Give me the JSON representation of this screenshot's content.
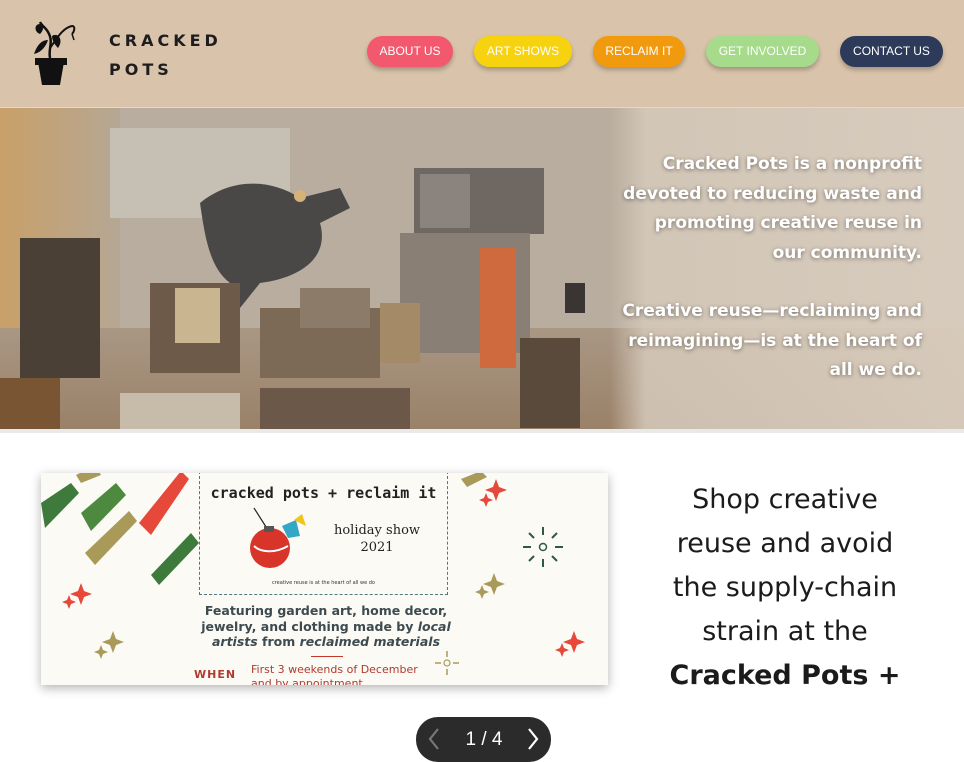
{
  "brand": {
    "line1": "CRACKED",
    "line2": "POTS"
  },
  "nav": [
    {
      "label": "ABOUT US",
      "color": "#f2586e"
    },
    {
      "label": "ART SHOWS",
      "color": "#f7d20e"
    },
    {
      "label": "RECLAIM IT",
      "color": "#f19a0e"
    },
    {
      "label": "GET INVOLVED",
      "color": "#a6db8b"
    },
    {
      "label": "CONTACT US",
      "color": "#2d3a5a"
    }
  ],
  "hero": {
    "para1": "Cracked Pots is a nonprofit devoted to reducing waste and promoting creative reuse in our community.",
    "para2": "Creative reuse—reclaiming and reimagining—is at the heart of all we do."
  },
  "slide": {
    "title": "cracked pots + reclaim it",
    "subtitle1": "holiday show",
    "subtitle2": "2021",
    "tagline": "creative reuse is at the heart of all we do",
    "desc_line1": "Featuring garden art, home decor,",
    "desc_line2a": "jewelry, and clothing made by ",
    "desc_line2b": "local",
    "desc_line3a": "artists",
    "desc_line3b": " from ",
    "desc_line3c": "reclaimed materials",
    "when_label": "WHEN",
    "when_line1": "First 3 weekends of December",
    "when_line2": "and by appointment"
  },
  "promo": {
    "line1": "Shop creative",
    "line2": "reuse and avoid",
    "line3": "the supply-chain",
    "line4": "strain at the",
    "line5": "Cracked Pots +"
  },
  "slider": {
    "counter": "1 / 4"
  },
  "colors": {
    "header_bg": "#d9c4ab",
    "hero_text": "#ffffff",
    "slider_bg": "#2b2b2b"
  }
}
